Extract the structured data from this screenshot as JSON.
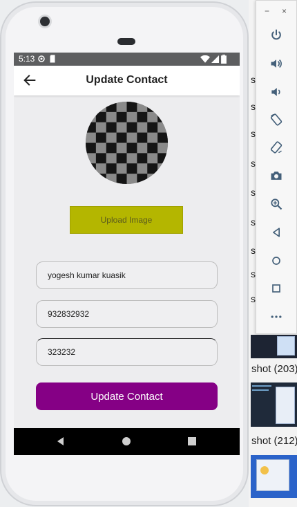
{
  "device": {
    "status_time": "5:13"
  },
  "app_bar": {
    "title": "Update Contact"
  },
  "form": {
    "upload_label": "Upload Image",
    "name_value": "yogesh kumar kuasik",
    "phone_value": "932832932",
    "extra_value": "323232",
    "submit_label": "Update Contact"
  },
  "emulator_toolbar": {
    "minimize": "−",
    "close": "×",
    "tools": [
      "power-icon",
      "volume-up-icon",
      "volume-down-icon",
      "rotate-left-icon",
      "rotate-right-icon",
      "camera-icon",
      "zoom-icon",
      "back-icon",
      "home-icon",
      "overview-icon",
      "more-icon"
    ]
  },
  "desktop": {
    "labels": [
      "shot (203)",
      "shot (212)"
    ],
    "letters": [
      "s",
      "s",
      "s",
      "s",
      "s",
      "s",
      "s",
      "s",
      "s"
    ]
  },
  "colors": {
    "upload_button": "#b4b600",
    "submit_button": "#850085"
  }
}
